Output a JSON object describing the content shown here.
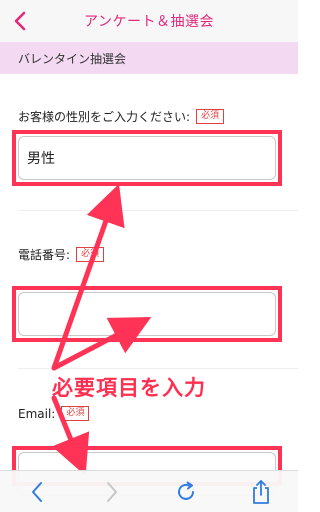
{
  "header": {
    "title": "アンケート＆抽選会",
    "back_icon": "chevron-left-icon",
    "accent_color": "#e2287b"
  },
  "section": {
    "title": "バレンタイン抽選会",
    "background_color": "#f3d9f2"
  },
  "form": {
    "fields": [
      {
        "label": "お客様の性別をご入力ください:",
        "badge": "必須",
        "value": "男性"
      },
      {
        "label": "電話番号:",
        "badge": "必須",
        "value": ""
      },
      {
        "label": "Email:",
        "badge": "必須",
        "value": ""
      }
    ]
  },
  "annotation": {
    "text": "必要項目を入力",
    "color": "#ff3355"
  },
  "toolbar": {
    "icons": [
      "back-icon",
      "forward-icon",
      "reload-icon",
      "share-icon"
    ],
    "active_color": "#2f7de1",
    "disabled_color": "#c7c7c7"
  }
}
